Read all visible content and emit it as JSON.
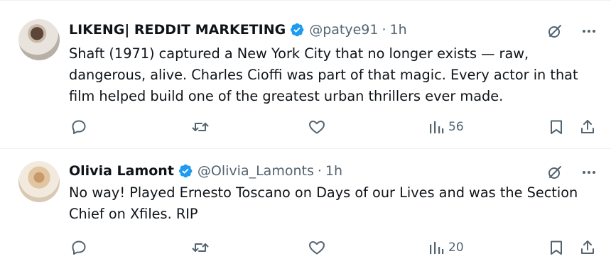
{
  "tweets": [
    {
      "author": "LIKENG| REDDIT MARKETING",
      "handle": "@patye91",
      "separator": "·",
      "time": "1h",
      "text": "Shaft (1971) captured a New York City that no longer exists — raw,\ndangerous, alive. Charles Cioffi was part of that magic. Every actor in that\nfilm helped build one of the greatest urban thrillers ever made.",
      "views": "56",
      "verified": true
    },
    {
      "author": "Olivia Lamont",
      "handle": "@Olivia_Lamonts",
      "separator": "·",
      "time": "1h",
      "text": "No way!  Played Ernesto Toscano on Days of our Lives and was the Section\nChief on Xfiles.  RIP",
      "views": "20",
      "verified": true
    }
  ],
  "colors": {
    "text_primary": "#0f1419",
    "text_secondary": "#536471",
    "verified_badge": "#1d9bf0",
    "divider": "#eff3f4"
  },
  "icons": [
    "verified-badge-icon",
    "grok-icon",
    "more-icon",
    "reply-icon",
    "retweet-icon",
    "like-icon",
    "views-icon",
    "bookmark-icon",
    "share-icon"
  ]
}
